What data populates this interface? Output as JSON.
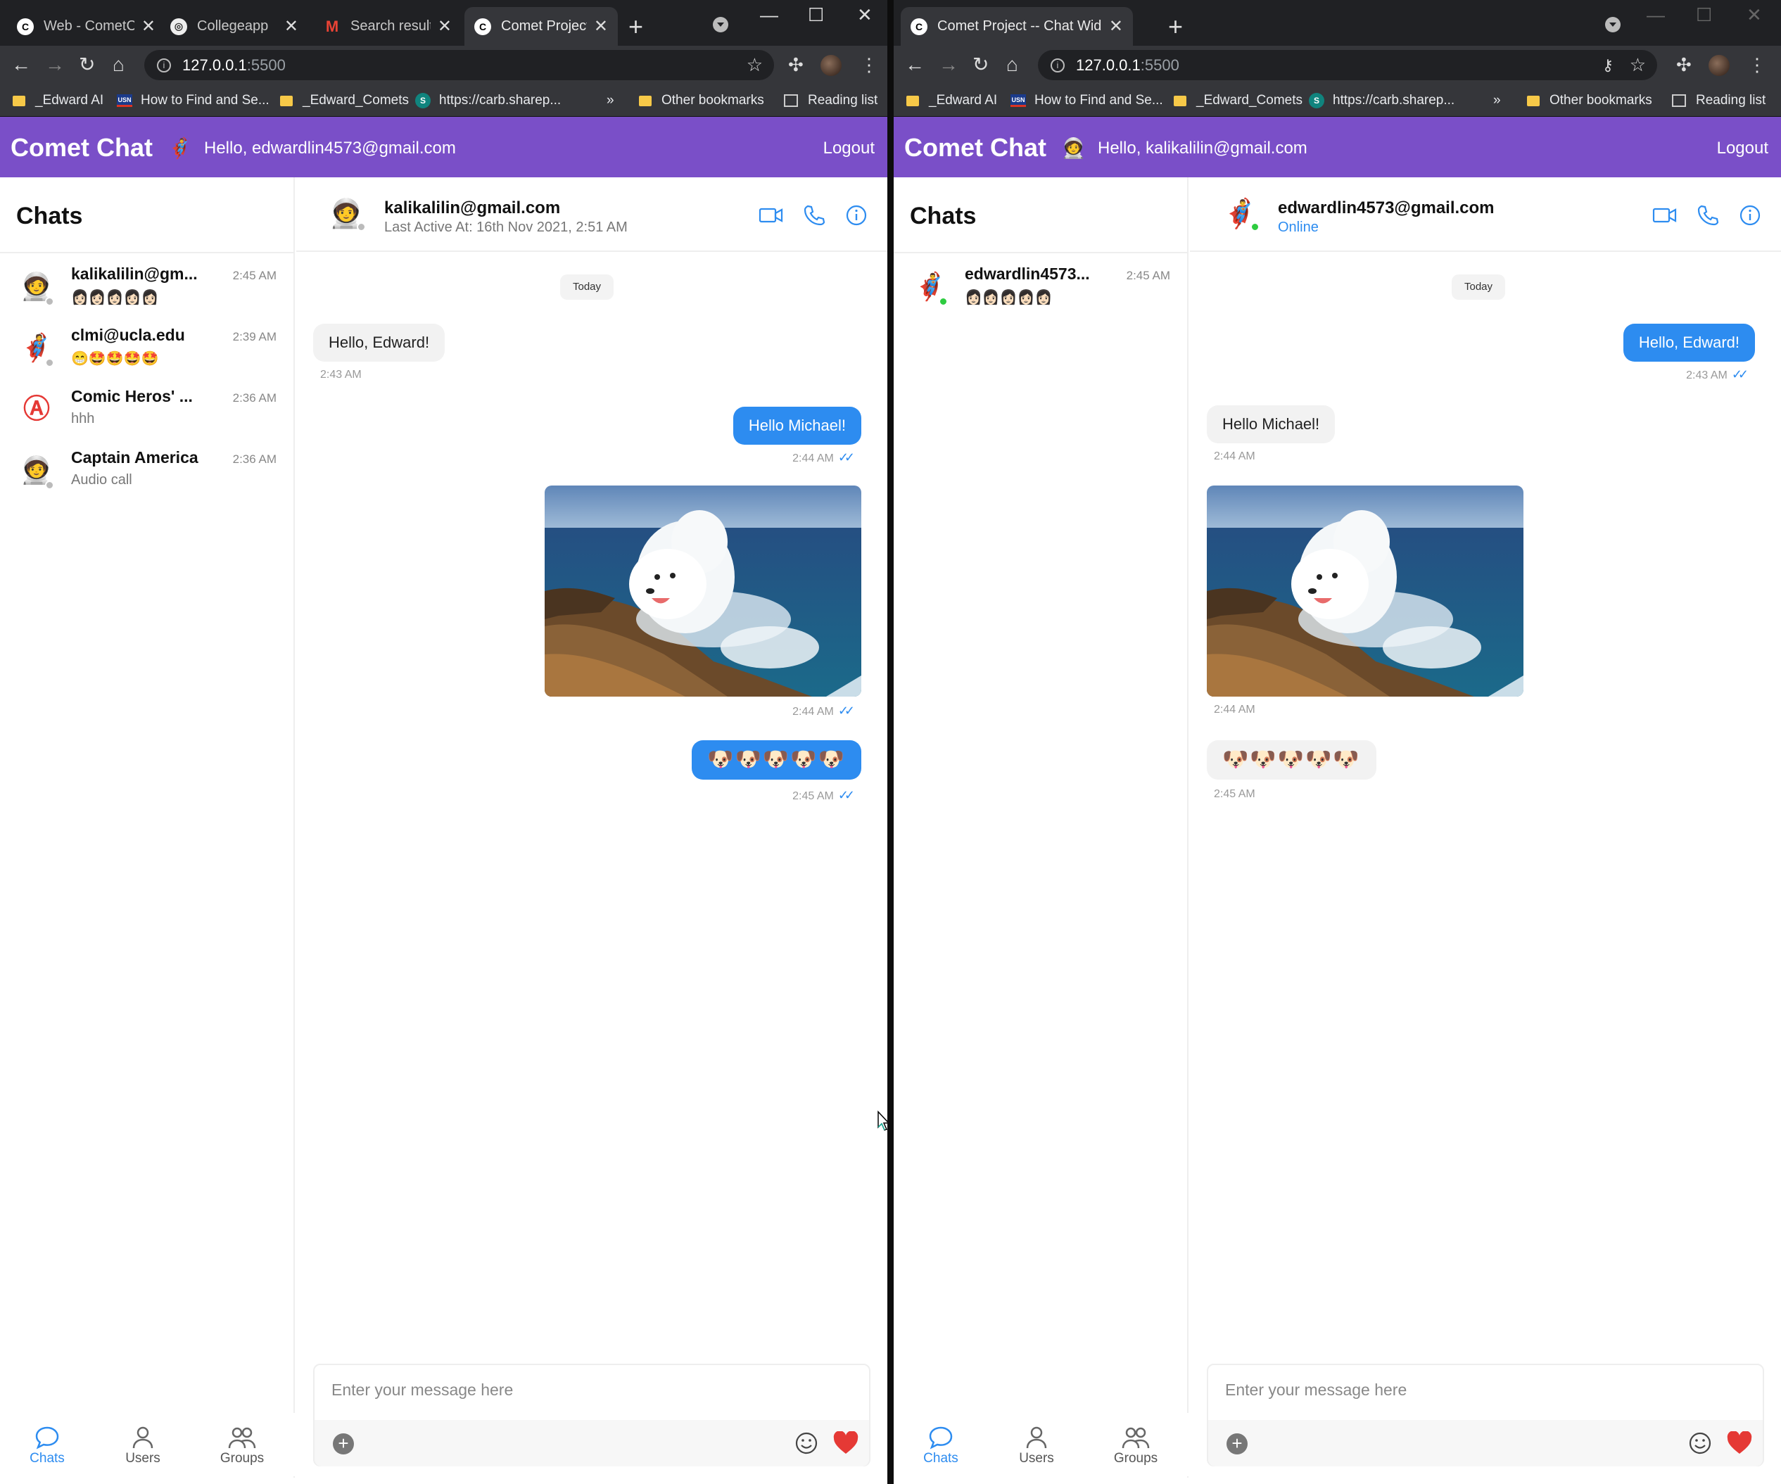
{
  "left": {
    "tabs": [
      {
        "label": "Web - CometC",
        "favicon": "C"
      },
      {
        "label": "Collegeapp",
        "favicon": "◎"
      },
      {
        "label": "Search results",
        "favicon": "M"
      },
      {
        "label": "Comet Project",
        "favicon": "C"
      }
    ],
    "url_host": "127.0.0.1",
    "url_port": ":5500",
    "user_email": "Hello, edwardlin4573@gmail.com",
    "user_avatar": "iron-man-avatar",
    "chats": [
      {
        "name": "kalikalilin@gm...",
        "preview": "👩🏻👩🏻👩🏻👩🏻👩🏻",
        "time": "2:45 AM",
        "avatar": "captain-america-avatar",
        "avatar_glyph": "🧑‍🚀"
      },
      {
        "name": "clmi@ucla.edu",
        "preview": "😁🤩🤩🤩🤩",
        "time": "2:39 AM",
        "avatar": "wolverine-avatar",
        "avatar_glyph": "🦸"
      },
      {
        "name": "Comic Heros' ...",
        "preview": "hhh",
        "time": "2:36 AM",
        "avatar": "avengers-logo-avatar",
        "avatar_glyph": "Ⓐ"
      },
      {
        "name": "Captain America",
        "preview": "Audio call",
        "time": "2:36 AM",
        "avatar": "captain-america-avatar",
        "avatar_glyph": "🧑‍🚀"
      }
    ],
    "header": {
      "name": "kalikalilin@gmail.com",
      "status": "Last Active At: 16th Nov 2021, 2:51 AM",
      "avatar_glyph": "🧑‍🚀"
    },
    "messages": [
      {
        "text": "Hello, Edward!",
        "time": "2:43 AM"
      },
      {
        "text": "Hello Michael!",
        "time": "2:44 AM"
      },
      {
        "image": "samoyed-wave-photo",
        "time": "2:44 AM"
      },
      {
        "text": "🐶🐶🐶🐶🐶",
        "time": "2:45 AM"
      }
    ]
  },
  "right": {
    "tabs": [
      {
        "label": "Comet Project -- Chat Widget",
        "favicon": "C"
      }
    ],
    "url_host": "127.0.0.1",
    "url_port": ":5500",
    "user_email": "Hello, kalikalilin@gmail.com",
    "user_avatar": "captain-america-avatar",
    "chats": [
      {
        "name": "edwardlin4573...",
        "preview": "👩🏻👩🏻👩🏻👩🏻👩🏻",
        "time": "2:45 AM",
        "avatar": "iron-man-avatar",
        "avatar_glyph": "🦸‍♂️"
      }
    ],
    "header": {
      "name": "edwardlin4573@gmail.com",
      "status": "Online",
      "avatar_glyph": "🦸‍♂️"
    },
    "messages": [
      {
        "text": "Hello, Edward!",
        "time": "2:43 AM"
      },
      {
        "text": "Hello Michael!",
        "time": "2:44 AM"
      },
      {
        "image": "samoyed-wave-photo",
        "time": "2:44 AM"
      },
      {
        "text": "🐶🐶🐶🐶🐶",
        "time": "2:45 AM"
      }
    ]
  },
  "bookmarks": [
    "_Edward AI",
    "How to Find and Se...",
    "_Edward_Comets",
    "https://carb.sharep...",
    "»",
    "Other bookmarks",
    "Reading list"
  ],
  "app": {
    "brand": "Comet Chat",
    "logout": "Logout",
    "chats_title": "Chats",
    "day_label": "Today",
    "composer_placeholder": "Enter your message here",
    "nav": [
      "Chats",
      "Users",
      "Groups"
    ]
  },
  "colors": {
    "brand": "#7a4fc8",
    "accent": "#2d8cf0",
    "heart": "#e53935",
    "online": "#2ecc40"
  }
}
